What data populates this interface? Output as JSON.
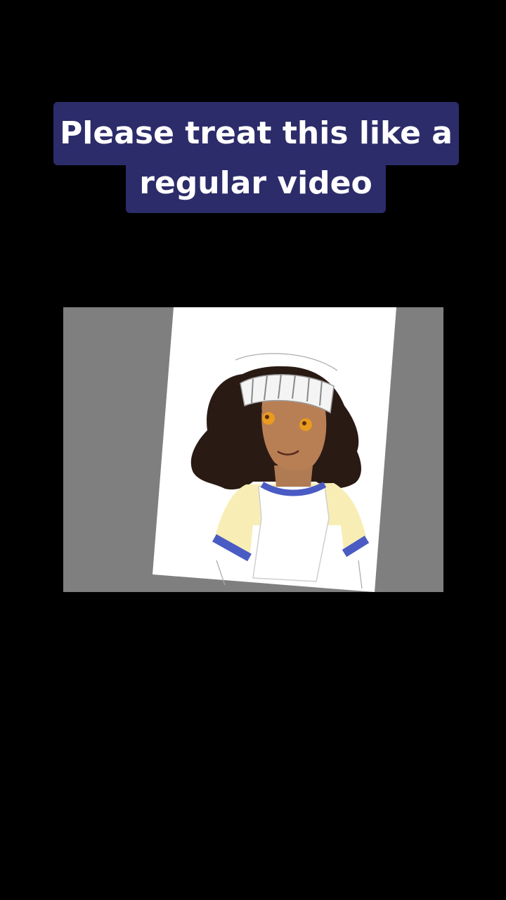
{
  "caption": {
    "line1": "Please treat this like a",
    "line2": "regular video"
  },
  "colors": {
    "background": "#000000",
    "caption_bg": "#2c2c6b",
    "caption_text": "#ffffff",
    "canvas_bg": "#7f7f7f"
  },
  "artwork": {
    "icon": "character-drawing"
  }
}
